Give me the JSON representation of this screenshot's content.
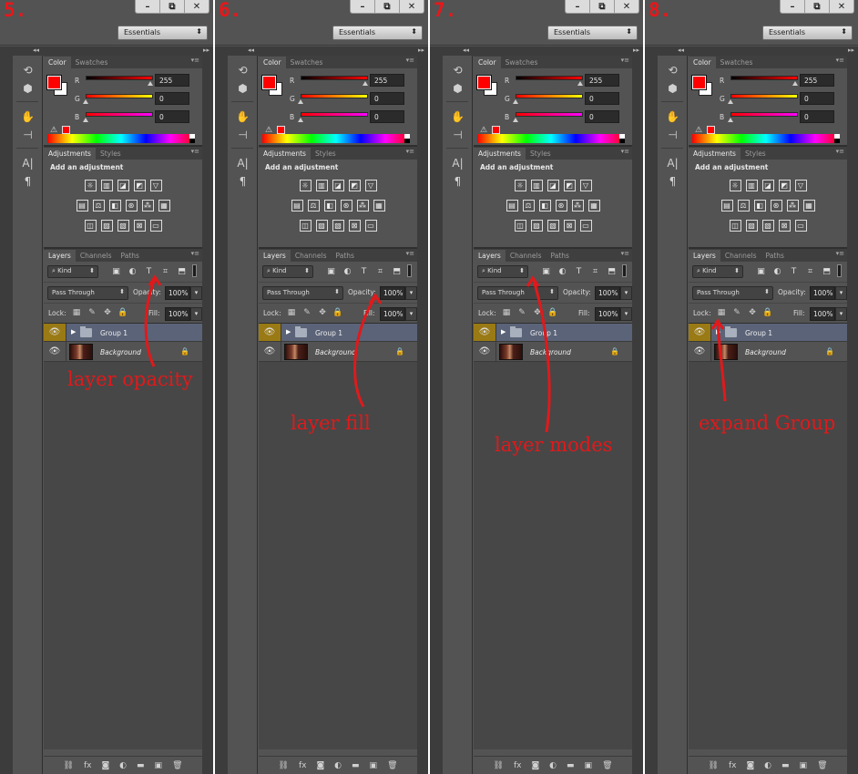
{
  "panels": [
    {
      "step": "5.",
      "annotation": "layer opacity",
      "wincontrols": [
        "–",
        "⧉",
        "✕"
      ],
      "workspace": "Essentials",
      "blend_mode": "Pass Through",
      "opacity": "100%",
      "fill": "100%",
      "color": {
        "r": "255",
        "g": "0",
        "b": "0"
      }
    },
    {
      "step": "6.",
      "annotation": "layer fill",
      "wincontrols": [
        "–",
        "⧉",
        "✕"
      ],
      "workspace": "Essentials",
      "blend_mode": "Pass Through",
      "opacity": "100%",
      "fill": "100%",
      "color": {
        "r": "255",
        "g": "0",
        "b": "0"
      }
    },
    {
      "step": "7.",
      "annotation": "layer modes",
      "wincontrols": [
        "–",
        "⧉",
        "✕"
      ],
      "workspace": "Essentials",
      "blend_mode": "Pass Through",
      "opacity": "100%",
      "fill": "100%",
      "color": {
        "r": "255",
        "g": "0",
        "b": "0"
      }
    },
    {
      "step": "8.",
      "annotation": "expand Group",
      "wincontrols": [
        "–",
        "⧉",
        "✕"
      ],
      "workspace": "Essentials",
      "blend_mode": "Pass Through",
      "opacity": "100%",
      "fill": "100%",
      "color": {
        "r": "255",
        "g": "0",
        "b": "0"
      }
    }
  ],
  "ui": {
    "color_tabs": [
      "Color",
      "Swatches"
    ],
    "adj_tabs": [
      "Adjustments",
      "Styles"
    ],
    "layers_tabs": [
      "Layers",
      "Channels",
      "Paths"
    ],
    "add_adjustment": "Add an adjustment",
    "kind": "Kind",
    "opacity_label": "Opacity:",
    "fill_label": "Fill:",
    "lock_label": "Lock:",
    "labels": {
      "r": "R",
      "g": "G",
      "b": "B"
    },
    "layers": {
      "group": "Group 1",
      "background": "Background"
    },
    "bottom_icons": [
      "⛓",
      "fx",
      "◙",
      "◐",
      "▬",
      "▣",
      "🗑"
    ],
    "tools": [
      "⟲",
      "⬢",
      "✋",
      "⊣",
      "A|",
      "¶"
    ],
    "adj_icons_row1": [
      "☼",
      "▥",
      "◪",
      "◩",
      "▽"
    ],
    "adj_icons_row2": [
      "▤",
      "⚖",
      "◧",
      "⊛",
      "⁂",
      "▦"
    ],
    "adj_icons_row3": [
      "◫",
      "▨",
      "▧",
      "⊠",
      "▭"
    ],
    "filter_icons": [
      "▣",
      "◐",
      "T",
      "⌗",
      "⬒"
    ],
    "lock_icons": [
      "▦",
      "✎",
      "✥",
      "🔒"
    ]
  },
  "colors": {
    "annotation": "#e1191b",
    "panel_bg": "#535353",
    "selected_group": "#5b6378",
    "eye_selected": "#9a7a15"
  }
}
